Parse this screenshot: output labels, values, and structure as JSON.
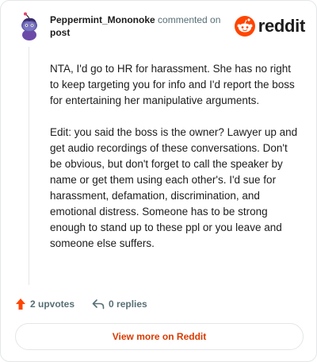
{
  "comment": {
    "username": "Peppermint_Mononoke",
    "action_text": "commented on",
    "target_link": "post",
    "paragraphs": [
      "NTA, I'd go to HR for harassment. She has no right to keep targeting you for info and I'd report the boss for entertaining her manipulative arguments.",
      "Edit: you said the boss is the owner? Lawyer up and get audio recordings of these conversations. Don't be obvious, but don't forget to call the speaker by name or get them using each other's. I'd sue for harassment, defamation, discrimination, and emotional distress. Someone has to be strong enough to stand up to these ppl or you leave and someone else suffers."
    ]
  },
  "brand": {
    "name": "reddit",
    "icon": "reddit-logo-icon",
    "color": "#ff4500"
  },
  "actions": {
    "upvotes": "2 upvotes",
    "replies": "0 replies"
  },
  "footer": {
    "view_more_label": "View more on Reddit"
  },
  "colors": {
    "accent": "#d93a00",
    "upvote": "#ff4500",
    "muted": "#576f76"
  }
}
